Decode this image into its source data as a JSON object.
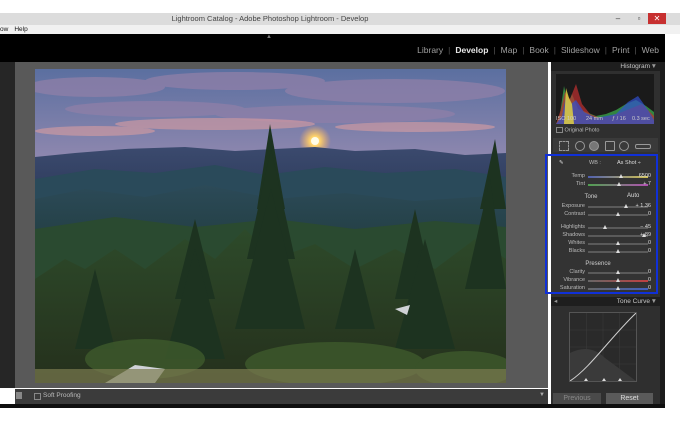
{
  "window": {
    "title": "Lightroom Catalog - Adobe Photoshop Lightroom - Develop"
  },
  "menu": [
    "ow",
    "Help"
  ],
  "modules": [
    {
      "label": "Library",
      "active": false
    },
    {
      "label": "Develop",
      "active": true
    },
    {
      "label": "Map",
      "active": false
    },
    {
      "label": "Book",
      "active": false
    },
    {
      "label": "Slideshow",
      "active": false
    },
    {
      "label": "Print",
      "active": false
    },
    {
      "label": "Web",
      "active": false
    }
  ],
  "histogram": {
    "title": "Histogram",
    "info": [
      "ISO 100",
      "24 mm",
      "ƒ / 16",
      "0.3 sec"
    ],
    "original_photo": "Original Photo"
  },
  "basic": {
    "wb": {
      "label": "WB :",
      "value": "As Shot ÷"
    },
    "temp": {
      "label": "Temp",
      "value": "6500",
      "pos": 0.55
    },
    "tint": {
      "label": "Tint",
      "value": "+ 7",
      "pos": 0.52
    },
    "tone": {
      "label": "Tone",
      "auto": "Auto"
    },
    "exposure": {
      "label": "Exposure",
      "value": "+ 1.36",
      "pos": 0.64
    },
    "contrast": {
      "label": "Contrast",
      "value": "0",
      "pos": 0.5
    },
    "highlights": {
      "label": "Highlights",
      "value": "− 45",
      "pos": 0.28
    },
    "shadows": {
      "label": "Shadows",
      "value": "+ 89",
      "pos": 0.94
    },
    "whites": {
      "label": "Whites",
      "value": "0",
      "pos": 0.5
    },
    "blacks": {
      "label": "Blacks",
      "value": "0",
      "pos": 0.5
    },
    "presence": {
      "label": "Presence"
    },
    "clarity": {
      "label": "Clarity",
      "value": "0",
      "pos": 0.5
    },
    "vibrance": {
      "label": "Vibrance",
      "value": "0",
      "pos": 0.5
    },
    "saturation": {
      "label": "Saturation",
      "value": "0",
      "pos": 0.5
    }
  },
  "tone_curve": {
    "title": "Tone Curve"
  },
  "toolbar": {
    "soft_proofing": "Soft Proofing"
  },
  "buttons": {
    "previous": "Previous",
    "reset": "Reset"
  }
}
